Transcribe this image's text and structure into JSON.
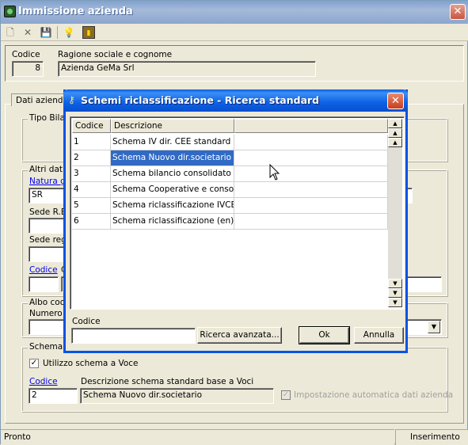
{
  "window": {
    "title": "Immissione azienda",
    "close_glyph": "✕"
  },
  "toolbar": {
    "icons": [
      "new-icon",
      "delete-icon",
      "save-icon",
      "info-icon",
      "exit-icon"
    ]
  },
  "header": {
    "codice_label": "Codice",
    "codice_value": "8",
    "ragione_label": "Ragione sociale e cognome",
    "ragione_value": "Azienda GeMa Srl"
  },
  "tab": {
    "label": "Dati azienda"
  },
  "left": {
    "tipo_bilancio": "Tipo Bilan",
    "altri_dati": "Altri dati a",
    "natura_label": "Natura giu",
    "natura_value": "SR",
    "sede_re": "Sede R.E.",
    "sede_reg": "Sede regi",
    "codice_link": "Codice",
    "codice_char": "C",
    "albo": "Albo coop",
    "numero": "Numero is"
  },
  "schema": {
    "group": "Schema",
    "checkbox_label": "Utilizzo schema a Voce",
    "checked": true,
    "codice_link": "Codice",
    "codice_value": "2",
    "desc_label": "Descrizione schema standard base a Voci",
    "desc_value": "Schema Nuovo dir.societario",
    "auto_label": "Impostazione automatica dati azienda"
  },
  "status": {
    "left": "Pronto",
    "right": "Inserimento"
  },
  "dialog": {
    "title": "Schemi riclassificazione - Ricerca standard",
    "close_glyph": "✕",
    "col_codice": "Codice",
    "col_descrizione": "Descrizione",
    "rows": [
      {
        "code": "1",
        "desc": "Schema IV dir. CEE standard"
      },
      {
        "code": "2",
        "desc": "Schema Nuovo dir.societario"
      },
      {
        "code": "3",
        "desc": "Schema bilancio consolidato"
      },
      {
        "code": "4",
        "desc": "Schema Cooperative e consorzi"
      },
      {
        "code": "5",
        "desc": "Schema riclassificazione IVCEE"
      },
      {
        "code": "6",
        "desc": "Schema riclassificazione (en)"
      }
    ],
    "selected_row": 2,
    "codice_label": "Codice",
    "btn_ricerca": "Ricerca avanzata...",
    "btn_ok": "Ok",
    "btn_annulla": "Annulla"
  }
}
